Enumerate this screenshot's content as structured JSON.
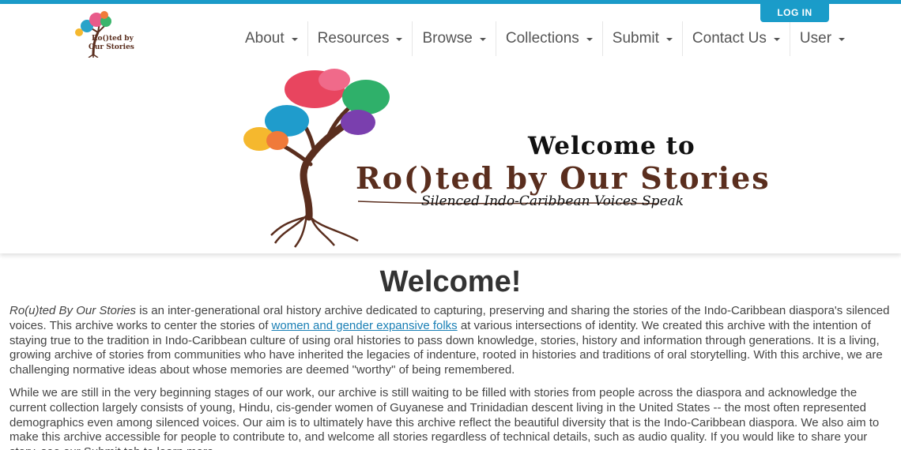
{
  "colors": {
    "accent": "#1b9bc9",
    "link": "#1a7fb5",
    "brand_brown": "#5a2e1e"
  },
  "header": {
    "login_label": "LOG IN",
    "logo_text_line1": "Ro()ted by",
    "logo_text_line2": "Our Stories"
  },
  "nav": {
    "items": [
      {
        "label": "About",
        "icon": "caret-down-icon"
      },
      {
        "label": "Resources",
        "icon": "caret-down-icon"
      },
      {
        "label": "Browse",
        "icon": "caret-down-icon"
      },
      {
        "label": "Collections",
        "icon": "caret-down-icon"
      },
      {
        "label": "Submit",
        "icon": "caret-down-icon"
      },
      {
        "label": "Contact Us",
        "icon": "caret-down-icon"
      },
      {
        "label": "User",
        "icon": "caret-down-icon"
      }
    ]
  },
  "hero": {
    "title": "Welcome to",
    "brand": "Ro()ted by Our Stories",
    "tagline": "Silenced Indo-Caribbean Voices Speak"
  },
  "main": {
    "heading": "Welcome!",
    "p1_em": "Ro(u)ted By Our Stories",
    "p1_a": " is an inter-generational oral history archive dedicated to capturing, preserving and sharing the stories of the Indo-Caribbean diaspora's silenced voices. This archive works to center the stories of ",
    "p1_link": "women and gender expansive folks",
    "p1_b": " at various intersections of identity. We created this archive with the intention of staying true to the tradition in Indo-Caribbean culture of using oral histories to pass down knowledge, stories, history and information through generations. It is a living, growing archive of stories from communities who have inherited the legacies of indenture, rooted in histories and traditions of oral storytelling. With this archive, we are challenging normative ideas about whose memories are deemed \"worthy\" of being remembered.",
    "p2": "While we are still in the very beginning stages of our work, our archive is still waiting to be filled with stories from people across the diaspora and acknowledge the current collection largely consists of young, Hindu, cis-gender women of Guyanese and Trinidadian descent living in the United States -- the most often represented demographics even among silenced voices. Our aim is to ultimately have this archive reflect the beautiful diversity that is the Indo-Caribbean diaspora. We also aim to make this archive accessible for people to contribute to, and welcome all stories regardless of technical details, such as audio quality. If you would like to share your story, see our Submit tab to learn more."
  }
}
